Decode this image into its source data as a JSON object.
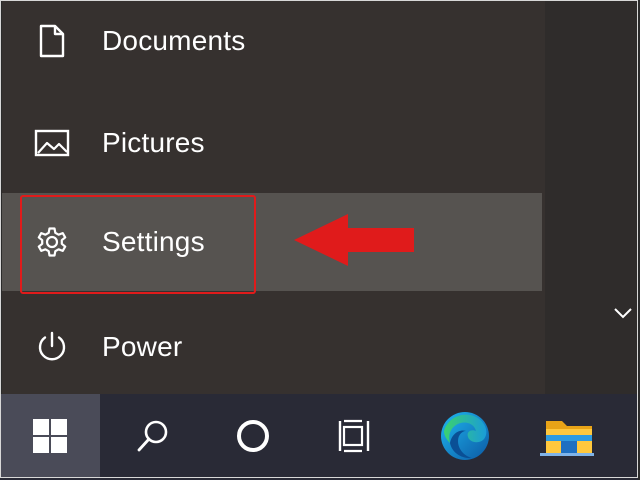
{
  "start_menu": {
    "items": [
      {
        "label": "Documents",
        "icon": "document-icon"
      },
      {
        "label": "Pictures",
        "icon": "picture-icon"
      },
      {
        "label": "Settings",
        "icon": "gear-icon"
      },
      {
        "label": "Power",
        "icon": "power-icon"
      }
    ]
  },
  "annotation": {
    "highlight_color": "#e01b1b",
    "arrow_color": "#e01b1b"
  },
  "taskbar": {
    "buttons": [
      {
        "icon": "windows-logo-icon"
      },
      {
        "icon": "search-icon"
      },
      {
        "icon": "cortana-icon"
      },
      {
        "icon": "task-view-icon"
      },
      {
        "icon": "edge-icon"
      },
      {
        "icon": "file-explorer-icon"
      }
    ],
    "accent_color": "#7fb3e8"
  }
}
